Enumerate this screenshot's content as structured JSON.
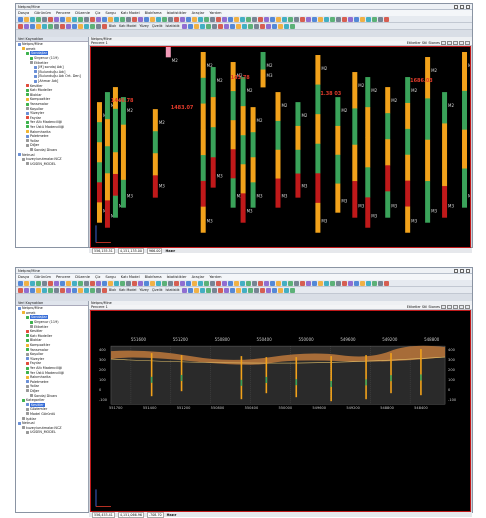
{
  "app_title": "Netpro/Mine",
  "menu": [
    "Dosya",
    "Görünüm",
    "Pencere",
    "Düzenle",
    "Çiz",
    "Sorgu",
    "Katı Model",
    "Blokfama",
    "İstatistikler",
    "Araçlar",
    "Yardım"
  ],
  "toolbar": {
    "blok_label": "Blok",
    "kat_model_label": "Katı Model",
    "yuzey_label": "Yüzey",
    "cizelik_label": "Çizelik",
    "istatistik_label": "İstatistik"
  },
  "tree": {
    "header": "Veri Kaynakları",
    "items": [
      {
        "label": "Netpro/Mine",
        "depth": 0,
        "color": "#6a8fd6"
      },
      {
        "label": "omek",
        "depth": 1,
        "color": "#f0b431"
      },
      {
        "label": "Sondajlar",
        "depth": 2,
        "color": "#3db24c"
      },
      {
        "label": "Sirgenur (119)",
        "depth": 3,
        "color": "#3db24c"
      },
      {
        "label": "Etiketler",
        "depth": 3,
        "color": "#999"
      },
      {
        "label": "[M] sondaj Adı]",
        "depth": 4,
        "color": "#6a8fd6"
      },
      {
        "label": "[Bulunduğu Adı]",
        "depth": 4,
        "color": "#6a8fd6"
      },
      {
        "label": "[Bulunduğu Adı Ort. Den]",
        "depth": 4,
        "color": "#6a8fd6"
      },
      {
        "label": "[Ahmar Adı]",
        "depth": 4,
        "color": "#6a8fd6"
      },
      {
        "label": "Kesitler",
        "depth": 2,
        "color": "#e04b3a"
      },
      {
        "label": "Katı Modeller",
        "depth": 2,
        "color": "#3db24c"
      },
      {
        "label": "Bloklar",
        "depth": 2,
        "color": "#3db24c"
      },
      {
        "label": "Kompozitler",
        "depth": 2,
        "color": "#f0b431"
      },
      {
        "label": "Yansımalar",
        "depth": 2,
        "color": "#3db24c"
      },
      {
        "label": "Koşullar",
        "depth": 2,
        "color": "#999"
      },
      {
        "label": "Yüzeyler",
        "depth": 2,
        "color": "#6a8fd6"
      },
      {
        "label": "Fayılar",
        "depth": 2,
        "color": "#e04b3a"
      },
      {
        "label": "Yer Altı Madenciliği",
        "depth": 2,
        "color": "#3db24c"
      },
      {
        "label": "Yer Üstü Madenciliği",
        "depth": 2,
        "color": "#3db24c"
      },
      {
        "label": "Rakımharita",
        "depth": 2,
        "color": "#f0b431"
      },
      {
        "label": "Paletmetre",
        "depth": 2,
        "color": "#6a8fd6"
      },
      {
        "label": "Yollar",
        "depth": 2,
        "color": "#999"
      },
      {
        "label": "Diğer",
        "depth": 2,
        "color": "#999"
      },
      {
        "label": "Sondaj Divanı",
        "depth": 3,
        "color": "#999"
      },
      {
        "label": "Netrual",
        "depth": 0,
        "color": "#6a8fd6"
      },
      {
        "label": "kuzeyiurutmalar.NCZ",
        "depth": 1,
        "color": "#999"
      },
      {
        "label": "UGSEN_MODEL",
        "depth": 2,
        "color": "#999"
      }
    ]
  },
  "tree2": {
    "header": "Veri Kaynakları",
    "items": [
      {
        "label": "Netpro/Mine",
        "depth": 0,
        "color": "#6a8fd6"
      },
      {
        "label": "omek",
        "depth": 1,
        "color": "#f0b431"
      },
      {
        "label": "Sondajlar",
        "depth": 2,
        "color": "#3db24c"
      },
      {
        "label": "Sirgenur (119)",
        "depth": 3,
        "color": "#3db24c"
      },
      {
        "label": "Etiketler",
        "depth": 3,
        "color": "#999"
      },
      {
        "label": "Kesitler",
        "depth": 2,
        "color": "#e04b3a"
      },
      {
        "label": "Katı Modeller",
        "depth": 2,
        "color": "#3db24c"
      },
      {
        "label": "Bloklar",
        "depth": 2,
        "color": "#3db24c"
      },
      {
        "label": "Kompozitler",
        "depth": 2,
        "color": "#f0b431"
      },
      {
        "label": "Yansımalar",
        "depth": 2,
        "color": "#3db24c"
      },
      {
        "label": "Koşullar",
        "depth": 2,
        "color": "#999"
      },
      {
        "label": "Yüzeyler",
        "depth": 2,
        "color": "#6a8fd6"
      },
      {
        "label": "Fayılar",
        "depth": 2,
        "color": "#e04b3a"
      },
      {
        "label": "Yer Altı Madenciliği",
        "depth": 2,
        "color": "#3db24c"
      },
      {
        "label": "Yer Üstü Madenciliği",
        "depth": 2,
        "color": "#3db24c"
      },
      {
        "label": "Rakımharita",
        "depth": 2,
        "color": "#f0b431"
      },
      {
        "label": "Paletmetre",
        "depth": 2,
        "color": "#6a8fd6"
      },
      {
        "label": "Yollar",
        "depth": 2,
        "color": "#999"
      },
      {
        "label": "Diğer",
        "depth": 2,
        "color": "#999"
      },
      {
        "label": "Sondaj Divanı",
        "depth": 3,
        "color": "#999"
      },
      {
        "label": "Kategoriler",
        "depth": 1,
        "color": "#3db24c"
      },
      {
        "label": "Kesitler",
        "depth": 2,
        "color": "#6a8fd6"
      },
      {
        "label": "Gözlemler",
        "depth": 2,
        "color": "#999"
      },
      {
        "label": "Model Görüntü",
        "depth": 2,
        "color": "#999"
      },
      {
        "label": "Işıklar",
        "depth": 1,
        "color": "#999"
      },
      {
        "label": "Netrual",
        "depth": 0,
        "color": "#6a8fd6"
      },
      {
        "label": "kuzeyiurutmalar.NCZ",
        "depth": 1,
        "color": "#999"
      },
      {
        "label": "UGSEN_MODEL",
        "depth": 2,
        "color": "#999"
      }
    ]
  },
  "view": {
    "tab": "Netpro/Mine",
    "window_label": "Pencere 1",
    "right_label": "Etiketler",
    "stil_label": "Stil",
    "stones_label": "Stones"
  },
  "status1": {
    "x": "556,155.51",
    "y": "4,151,135.00",
    "z": "966.00",
    "mode": "Hazır"
  },
  "status2": {
    "x": "556,453.41",
    "y": "4,151,066.96",
    "z": "-708.70",
    "mode": "Hazır"
  },
  "drill_labels": [
    {
      "text": "1446.78"
    },
    {
      "text": "1483.07"
    },
    {
      "text": "143.78"
    },
    {
      "text": "1.38 03"
    },
    {
      "text": "1686.03"
    }
  ],
  "section_axis_top": [
    "551600",
    "551200",
    "550800",
    "550400",
    "550000",
    "549600",
    "549200",
    "548800"
  ],
  "section_axis_bottom": [
    "551700",
    "551400",
    "551200",
    "550800",
    "550400",
    "550000",
    "549600",
    "549200",
    "548800",
    "548400"
  ],
  "section_y_left": [
    "400",
    "300",
    "200",
    "100",
    "0",
    "-100"
  ],
  "section_y_right": [
    "400",
    "300",
    "200",
    "100",
    "0",
    "-100"
  ],
  "colors": {
    "green": "#3aa35a",
    "orange": "#f2a21b",
    "red": "#c0191a",
    "pink": "#f29ab8"
  }
}
